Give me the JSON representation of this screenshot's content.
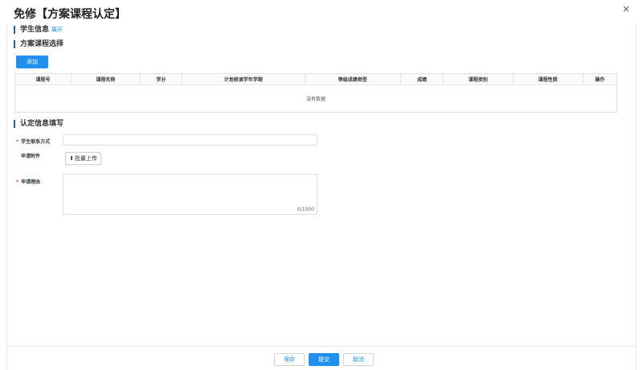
{
  "dialog": {
    "title": "免修【方案课程认定】",
    "close_glyph": "×"
  },
  "sections": {
    "student_info": {
      "title": "学生信息",
      "expand_label": "展开"
    },
    "course_select": {
      "title": "方案课程选择",
      "add_label": "添加"
    },
    "cert_info": {
      "title": "认定信息填写"
    }
  },
  "table": {
    "columns": [
      "课程号",
      "课程名称",
      "学分",
      "计划修读学年学期",
      "等级成绩类型",
      "成绩",
      "课程类别",
      "课程性质",
      "操作"
    ],
    "empty_text": "没有数据"
  },
  "form": {
    "contact_label": "学生联系方式",
    "contact_value": "",
    "attachment_label": "申请附件",
    "upload_label": "批量上传",
    "reason_label": "申请理由",
    "reason_value": "",
    "counter": "0/1000"
  },
  "footer": {
    "save_label": "保存",
    "submit_label": "提交",
    "cancel_label": "取消"
  },
  "colors": {
    "accent": "#1f8ff0",
    "section_bar": "#1e5fbf",
    "required": "#e53935"
  }
}
